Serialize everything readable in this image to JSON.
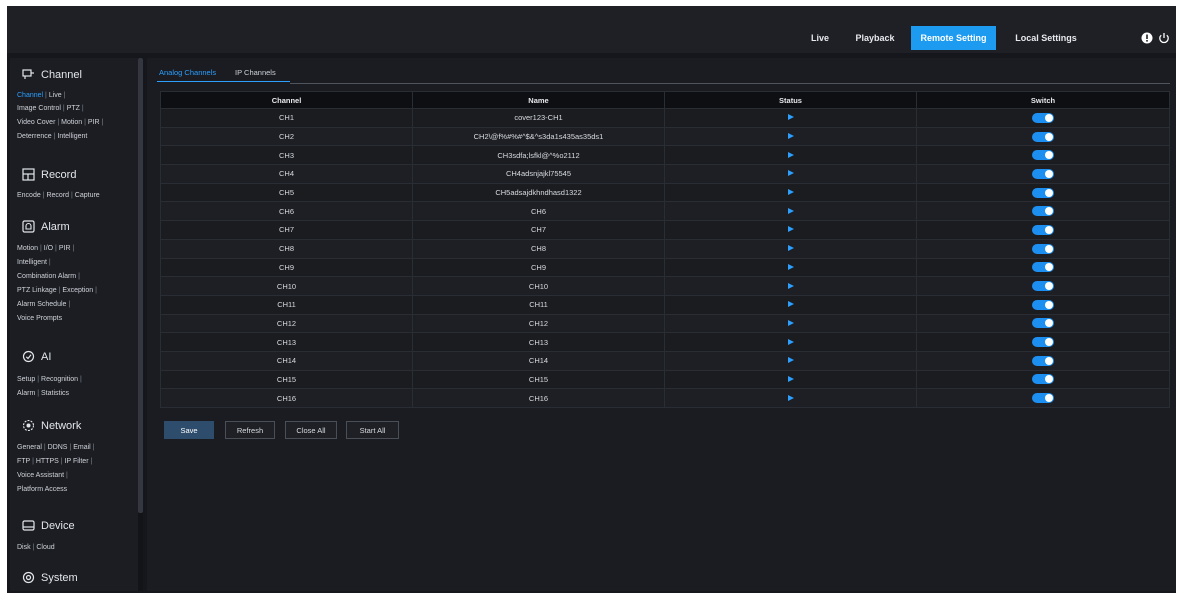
{
  "topnav": {
    "live": "Live",
    "playback": "Playback",
    "remote_setting": "Remote Setting",
    "local_settings": "Local Settings"
  },
  "sidebar": {
    "channel": {
      "title": "Channel",
      "items": [
        "Channel",
        "Live",
        "Image Control",
        "PTZ",
        "Video Cover",
        "Motion",
        "PIR",
        "Deterrence",
        "Intelligent"
      ]
    },
    "record": {
      "title": "Record",
      "items": [
        "Encode",
        "Record",
        "Capture"
      ]
    },
    "alarm": {
      "title": "Alarm",
      "items": [
        "Motion",
        "I/O",
        "PIR",
        "Intelligent",
        "Combination Alarm",
        "PTZ Linkage",
        "Exception",
        "Alarm Schedule",
        "Voice Prompts"
      ]
    },
    "ai": {
      "title": "AI",
      "items": [
        "Setup",
        "Recognition",
        "Alarm",
        "Statistics"
      ]
    },
    "network": {
      "title": "Network",
      "items": [
        "General",
        "DDNS",
        "Email",
        "FTP",
        "HTTPS",
        "IP Filter",
        "Voice Assistant",
        "Platform Access"
      ]
    },
    "device": {
      "title": "Device",
      "items": [
        "Disk",
        "Cloud"
      ]
    },
    "system": {
      "title": "System"
    }
  },
  "tabs": {
    "analog": "Analog Channels",
    "ip": "IP Channels"
  },
  "table": {
    "headers": [
      "Channel",
      "Name",
      "Status",
      "Switch"
    ],
    "rows": [
      {
        "channel": "CH1",
        "name": "cover123-CH1",
        "switch": "on"
      },
      {
        "channel": "CH2",
        "name": "CH2\\@f%#%#^$&^s3da1s435as35ds1",
        "switch": "on"
      },
      {
        "channel": "CH3",
        "name": "CH3sdfa;lsfkl@^%o2112",
        "switch": "on"
      },
      {
        "channel": "CH4",
        "name": "CH4adsnjajkl75545",
        "switch": "on"
      },
      {
        "channel": "CH5",
        "name": "CH5adsajdkhndhasd1322",
        "switch": "on"
      },
      {
        "channel": "CH6",
        "name": "CH6",
        "switch": "on"
      },
      {
        "channel": "CH7",
        "name": "CH7",
        "switch": "on"
      },
      {
        "channel": "CH8",
        "name": "CH8",
        "switch": "on"
      },
      {
        "channel": "CH9",
        "name": "CH9",
        "switch": "on"
      },
      {
        "channel": "CH10",
        "name": "CH10",
        "switch": "on"
      },
      {
        "channel": "CH11",
        "name": "CH11",
        "switch": "on"
      },
      {
        "channel": "CH12",
        "name": "CH12",
        "switch": "on"
      },
      {
        "channel": "CH13",
        "name": "CH13",
        "switch": "on"
      },
      {
        "channel": "CH14",
        "name": "CH14",
        "switch": "on"
      },
      {
        "channel": "CH15",
        "name": "CH15",
        "switch": "on"
      },
      {
        "channel": "CH16",
        "name": "CH16",
        "switch": "on"
      }
    ]
  },
  "buttons": {
    "save": "Save",
    "refresh": "Refresh",
    "close_all": "Close All",
    "start_all": "Start All"
  },
  "colors": {
    "accent": "#1d9bf0",
    "background": "#15171c",
    "toggle_on": "#1d8ff0"
  }
}
